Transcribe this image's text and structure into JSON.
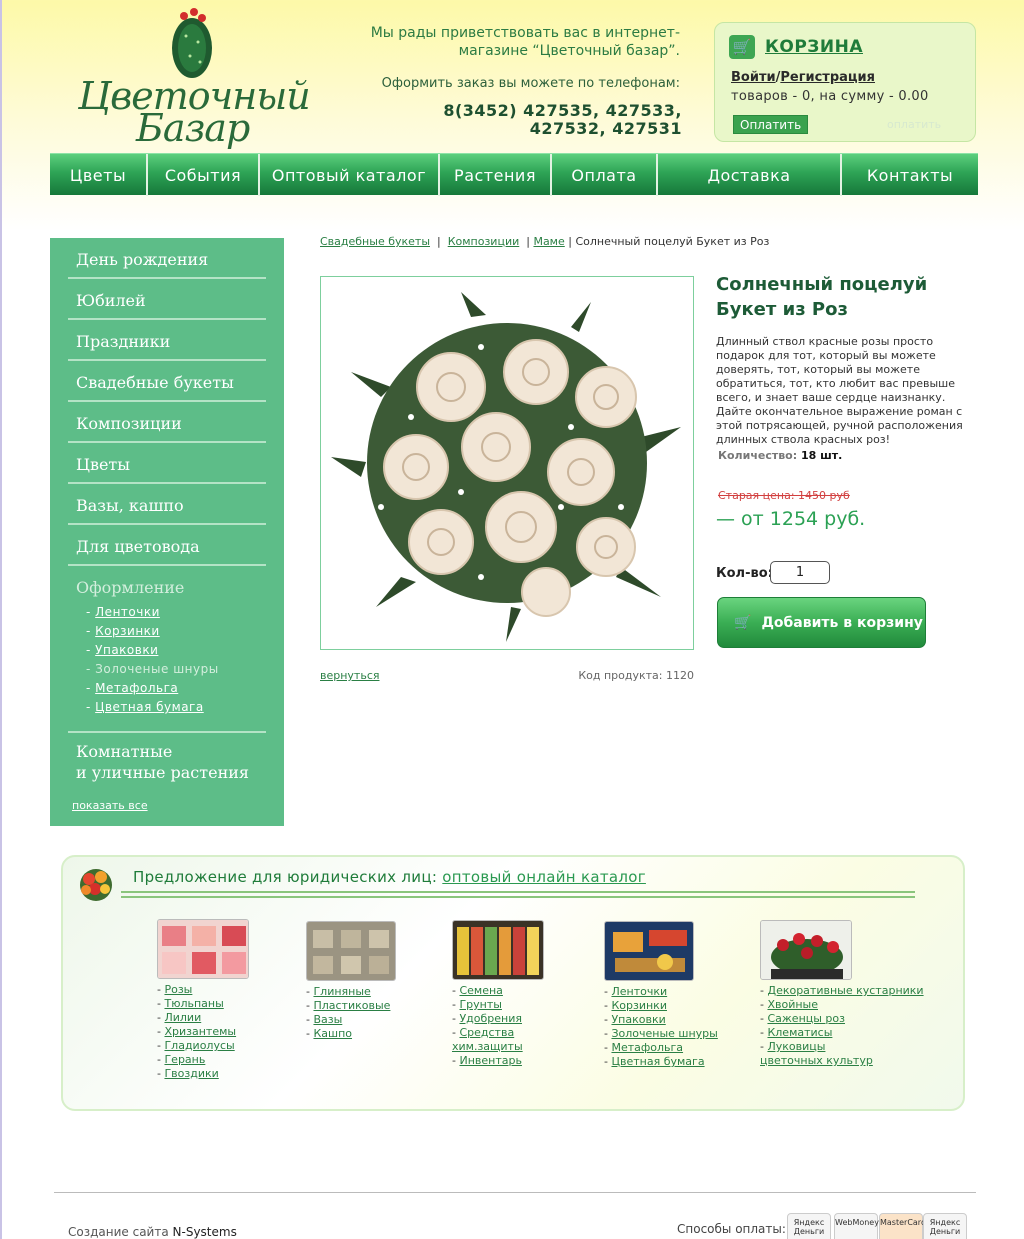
{
  "header": {
    "logo_line1": "Цветочный",
    "logo_line2": "Базар",
    "welcome": "Мы рады приветствовать вас в интернет-магазине “Цветочный базар”.",
    "phone_label": "Оформить заказ вы можете по телефонам:",
    "phones_line1": "8(3452) 427535, 427533,",
    "phones_line2": "427532, 427531"
  },
  "cart": {
    "title": "КОРЗИНА",
    "login": "Войти",
    "register": "Регистрация",
    "info": "товаров - 0, на сумму - 0.00",
    "pay_button": "Оплатить",
    "pay_ghost": "оплатить"
  },
  "nav": [
    "Цветы",
    "События",
    "Оптовый каталог",
    "Растения",
    "Оплата",
    "Доставка",
    "Контакты"
  ],
  "sidebar": {
    "items": [
      "День рождения",
      "Юбилей",
      "Праздники",
      "Свадебные букеты",
      "Композиции",
      "Цветы",
      "Вазы, кашпо",
      "Для цветовода"
    ],
    "section": "Оформление",
    "subitems": [
      "Ленточки",
      "Корзинки",
      "Упаковки",
      "Золоченые шнуры",
      "Метафольга",
      "Цветная бумага"
    ],
    "plants_line1": "Комнатные",
    "plants_line2": "и уличные растения",
    "show_all": "показать все"
  },
  "breadcrumb": {
    "items": [
      "Свадебные букеты",
      "Композиции",
      "Маме"
    ],
    "current": "Солнечный поцелуй Букет из Роз"
  },
  "product": {
    "title_line1": "Солнечный поцелуй",
    "title_line2": "Букет из Роз",
    "description": "Длинный ствол красные розы просто подарок для тот, который вы можете доверять, тот, который вы можете обратиться, тот, кто любит вас превыше всего, и знает ваше сердце наизнанку. Дайте окончательное выражение роман с этой потрясающей, ручной расположения длинных ствола красных роз!",
    "qty_label": "Количество:",
    "qty_value": "18 шт.",
    "old_price": "Старая цена: 1450 руб",
    "new_price": "— от 1254 руб.",
    "kolvo_label": "Кол-во:",
    "kolvo_value": "1",
    "add_button": "Добавить в корзину",
    "back_link": "вернуться",
    "code": "Код продукта: 1120"
  },
  "wholesale": {
    "title_prefix": "Предложение для юридических лиц:",
    "title_link": "оптовый онлайн каталог",
    "col1": [
      "Розы",
      "Тюльпаны",
      "Лилии",
      "Хризантемы",
      "Гладиолусы",
      "Герань",
      "Гвоздики"
    ],
    "col2": [
      "Глиняные",
      "Пластиковые",
      "Вазы",
      "Кашпо"
    ],
    "col3": [
      "Семена",
      "Грунты",
      "Удобрения",
      "Средства хим.защиты",
      "Инвентарь"
    ],
    "col4": [
      "Ленточки",
      "Корзинки",
      "Упаковки",
      "Золоченые шнуры",
      "Метафольга",
      "Цветная бумага"
    ],
    "col5": [
      "Декоративные кустарники",
      "Хвойные",
      "Саженцы роз",
      "Клематисы",
      "Луковицы цветочных культур"
    ]
  },
  "footer": {
    "created_prefix": "Создание сайта",
    "created_by": "N-Systems",
    "payment_label": "Способы оплаты:",
    "payment_methods": [
      "Яндекс Деньги",
      "WebMoney",
      "MasterCard",
      "Яндекс Деньги"
    ]
  },
  "colors": {
    "brand_green": "#2ea456",
    "sidebar_green": "#5dbd88",
    "link_green": "#2a7f44"
  }
}
